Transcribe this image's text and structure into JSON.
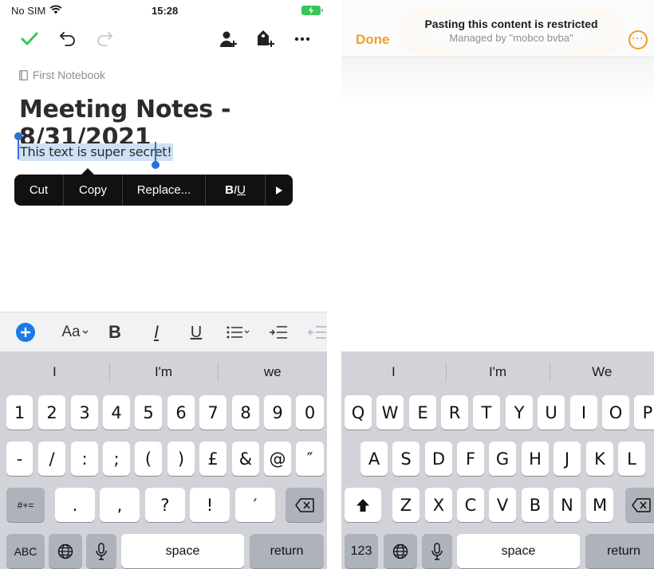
{
  "left": {
    "status": {
      "carrier": "No SIM",
      "time": "15:28"
    },
    "notebook": "First Notebook",
    "note_title": "Meeting Notes - 8/31/2021",
    "selected_text": "This text is super secret!",
    "context_menu": {
      "cut": "Cut",
      "copy": "Copy",
      "replace": "Replace...",
      "format_b": "B",
      "format_i": "I",
      "format_u": "U"
    },
    "format_toolbar": {
      "font_size": "Aa",
      "bold": "B",
      "italic": "I",
      "underline": "U"
    },
    "suggestions": [
      "I",
      "I'm",
      "we"
    ],
    "keys": {
      "row1": [
        "1",
        "2",
        "3",
        "4",
        "5",
        "6",
        "7",
        "8",
        "9",
        "0"
      ],
      "row2": [
        "-",
        "/",
        ":",
        ";",
        "(",
        ")",
        "£",
        "&",
        "@",
        "″"
      ],
      "row3": [
        ".",
        ",",
        "?",
        "!",
        "′"
      ],
      "symbols": "#+=",
      "abc": "ABC",
      "space": "space",
      "return": "return"
    }
  },
  "right": {
    "done_label": "Done",
    "toast_title": "Pasting this content is restricted",
    "toast_subtitle": "Managed by \"mobco bvba\"",
    "suggestions": [
      "I",
      "I'm",
      "We"
    ],
    "keys": {
      "row1": [
        "Q",
        "W",
        "E",
        "R",
        "T",
        "Y",
        "U",
        "I",
        "O",
        "P"
      ],
      "row2": [
        "A",
        "S",
        "D",
        "F",
        "G",
        "H",
        "J",
        "K",
        "L"
      ],
      "row3": [
        "Z",
        "X",
        "C",
        "V",
        "B",
        "N",
        "M"
      ],
      "numbers": "123",
      "space": "space",
      "return": "return"
    }
  },
  "colors": {
    "accent_green": "#34c759",
    "accent_orange": "#f39c2b",
    "selection_blue": "#2f6fd6"
  }
}
